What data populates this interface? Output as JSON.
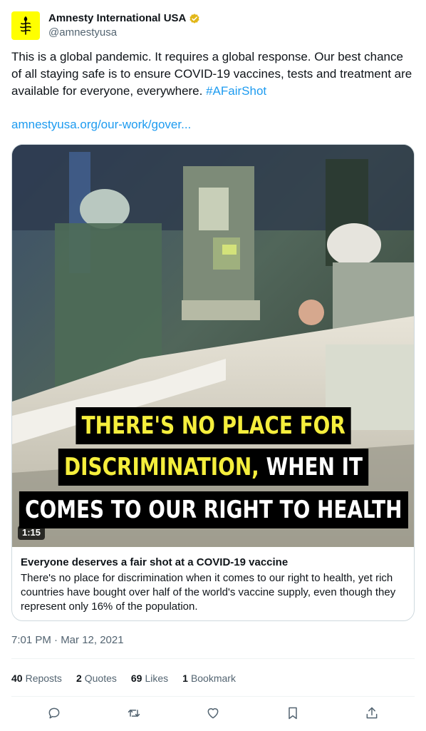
{
  "account": {
    "display_name": "Amnesty International USA",
    "handle": "@amnestyusa",
    "avatar_color": "#ffff00",
    "verified_badge_color": "#e2b719"
  },
  "tweet": {
    "text": "This is a global pandemic. It requires a global response. Our best chance of all staying safe is to ensure COVID-19 vaccines, tests and treatment are available for everyone, everywhere. ",
    "hashtag": "#AFairShot",
    "link": "amnestyusa.org/our-work/gover..."
  },
  "card": {
    "video_caption": {
      "line1": "THERE'S NO PLACE FOR",
      "line2_yellow": "DISCRIMINATION,",
      "line2_white": " WHEN IT",
      "line3": "COMES TO OUR RIGHT TO HEALTH"
    },
    "duration": "1:15",
    "title": "Everyone deserves a fair shot at a COVID-19 vaccine",
    "description": "There's no place for discrimination when it comes to our right to health, yet rich countries have bought over half of the world's vaccine supply, even though they represent only 16% of the population."
  },
  "timestamp": "7:01 PM · Mar 12, 2021",
  "stats": {
    "reposts_count": "40",
    "reposts_label": "Reposts",
    "quotes_count": "2",
    "quotes_label": "Quotes",
    "likes_count": "69",
    "likes_label": "Likes",
    "bookmarks_count": "1",
    "bookmarks_label": "Bookmark"
  },
  "actions": [
    "reply-icon",
    "repost-icon",
    "like-icon",
    "bookmark-icon",
    "share-icon"
  ],
  "colors": {
    "link_blue": "#1d9bf0",
    "muted_text": "#536471",
    "caption_yellow": "#f5ee3c"
  }
}
